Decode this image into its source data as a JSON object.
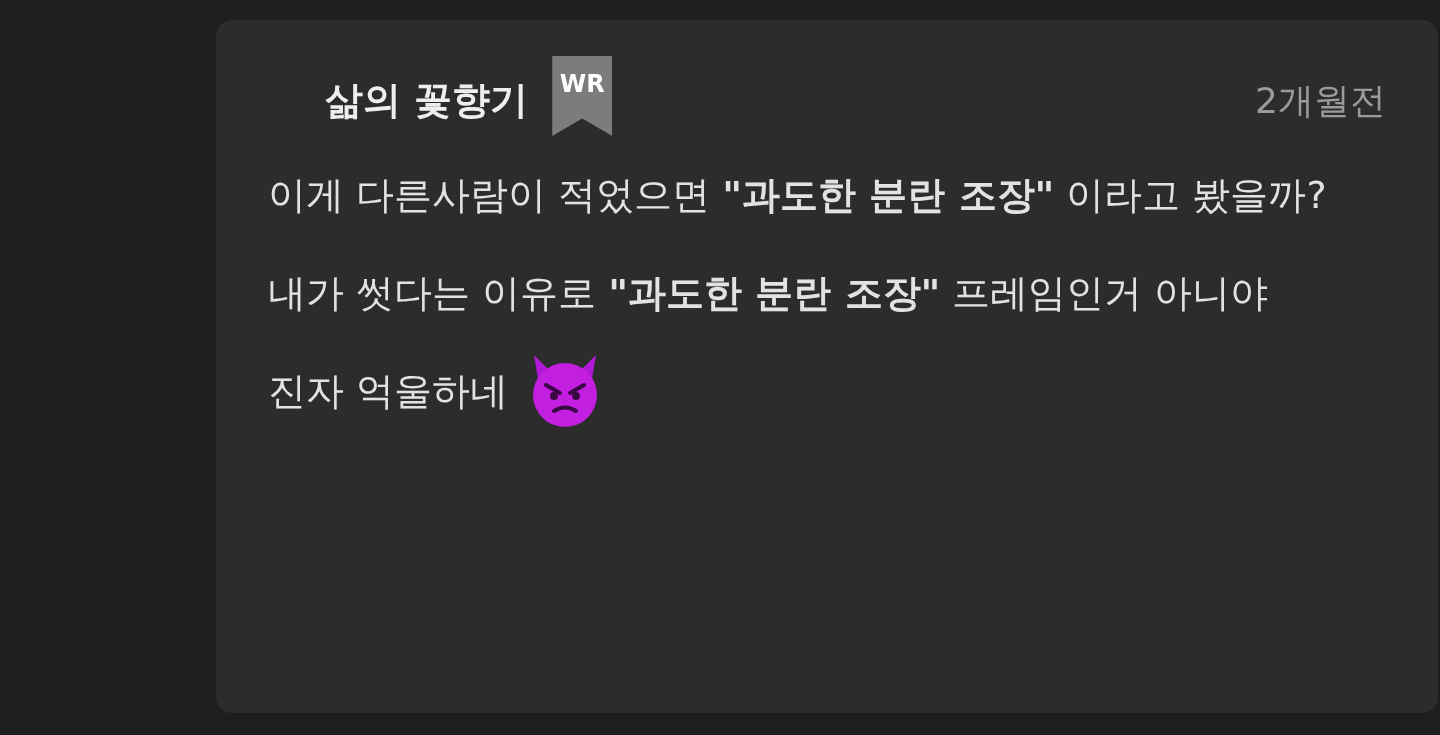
{
  "comment": {
    "author": "삶의 꽃향기",
    "badge": "WR",
    "time": "2개월전",
    "paragraphs": [
      "이게 다른사람이 적었으면 **\"과도한 분란 조장\"** 이라고 봤을까?",
      "내가 썻다는 이유로 **\"과도한 분란 조장\"** 프레임인거 아니야",
      "진자 억울하네"
    ]
  }
}
